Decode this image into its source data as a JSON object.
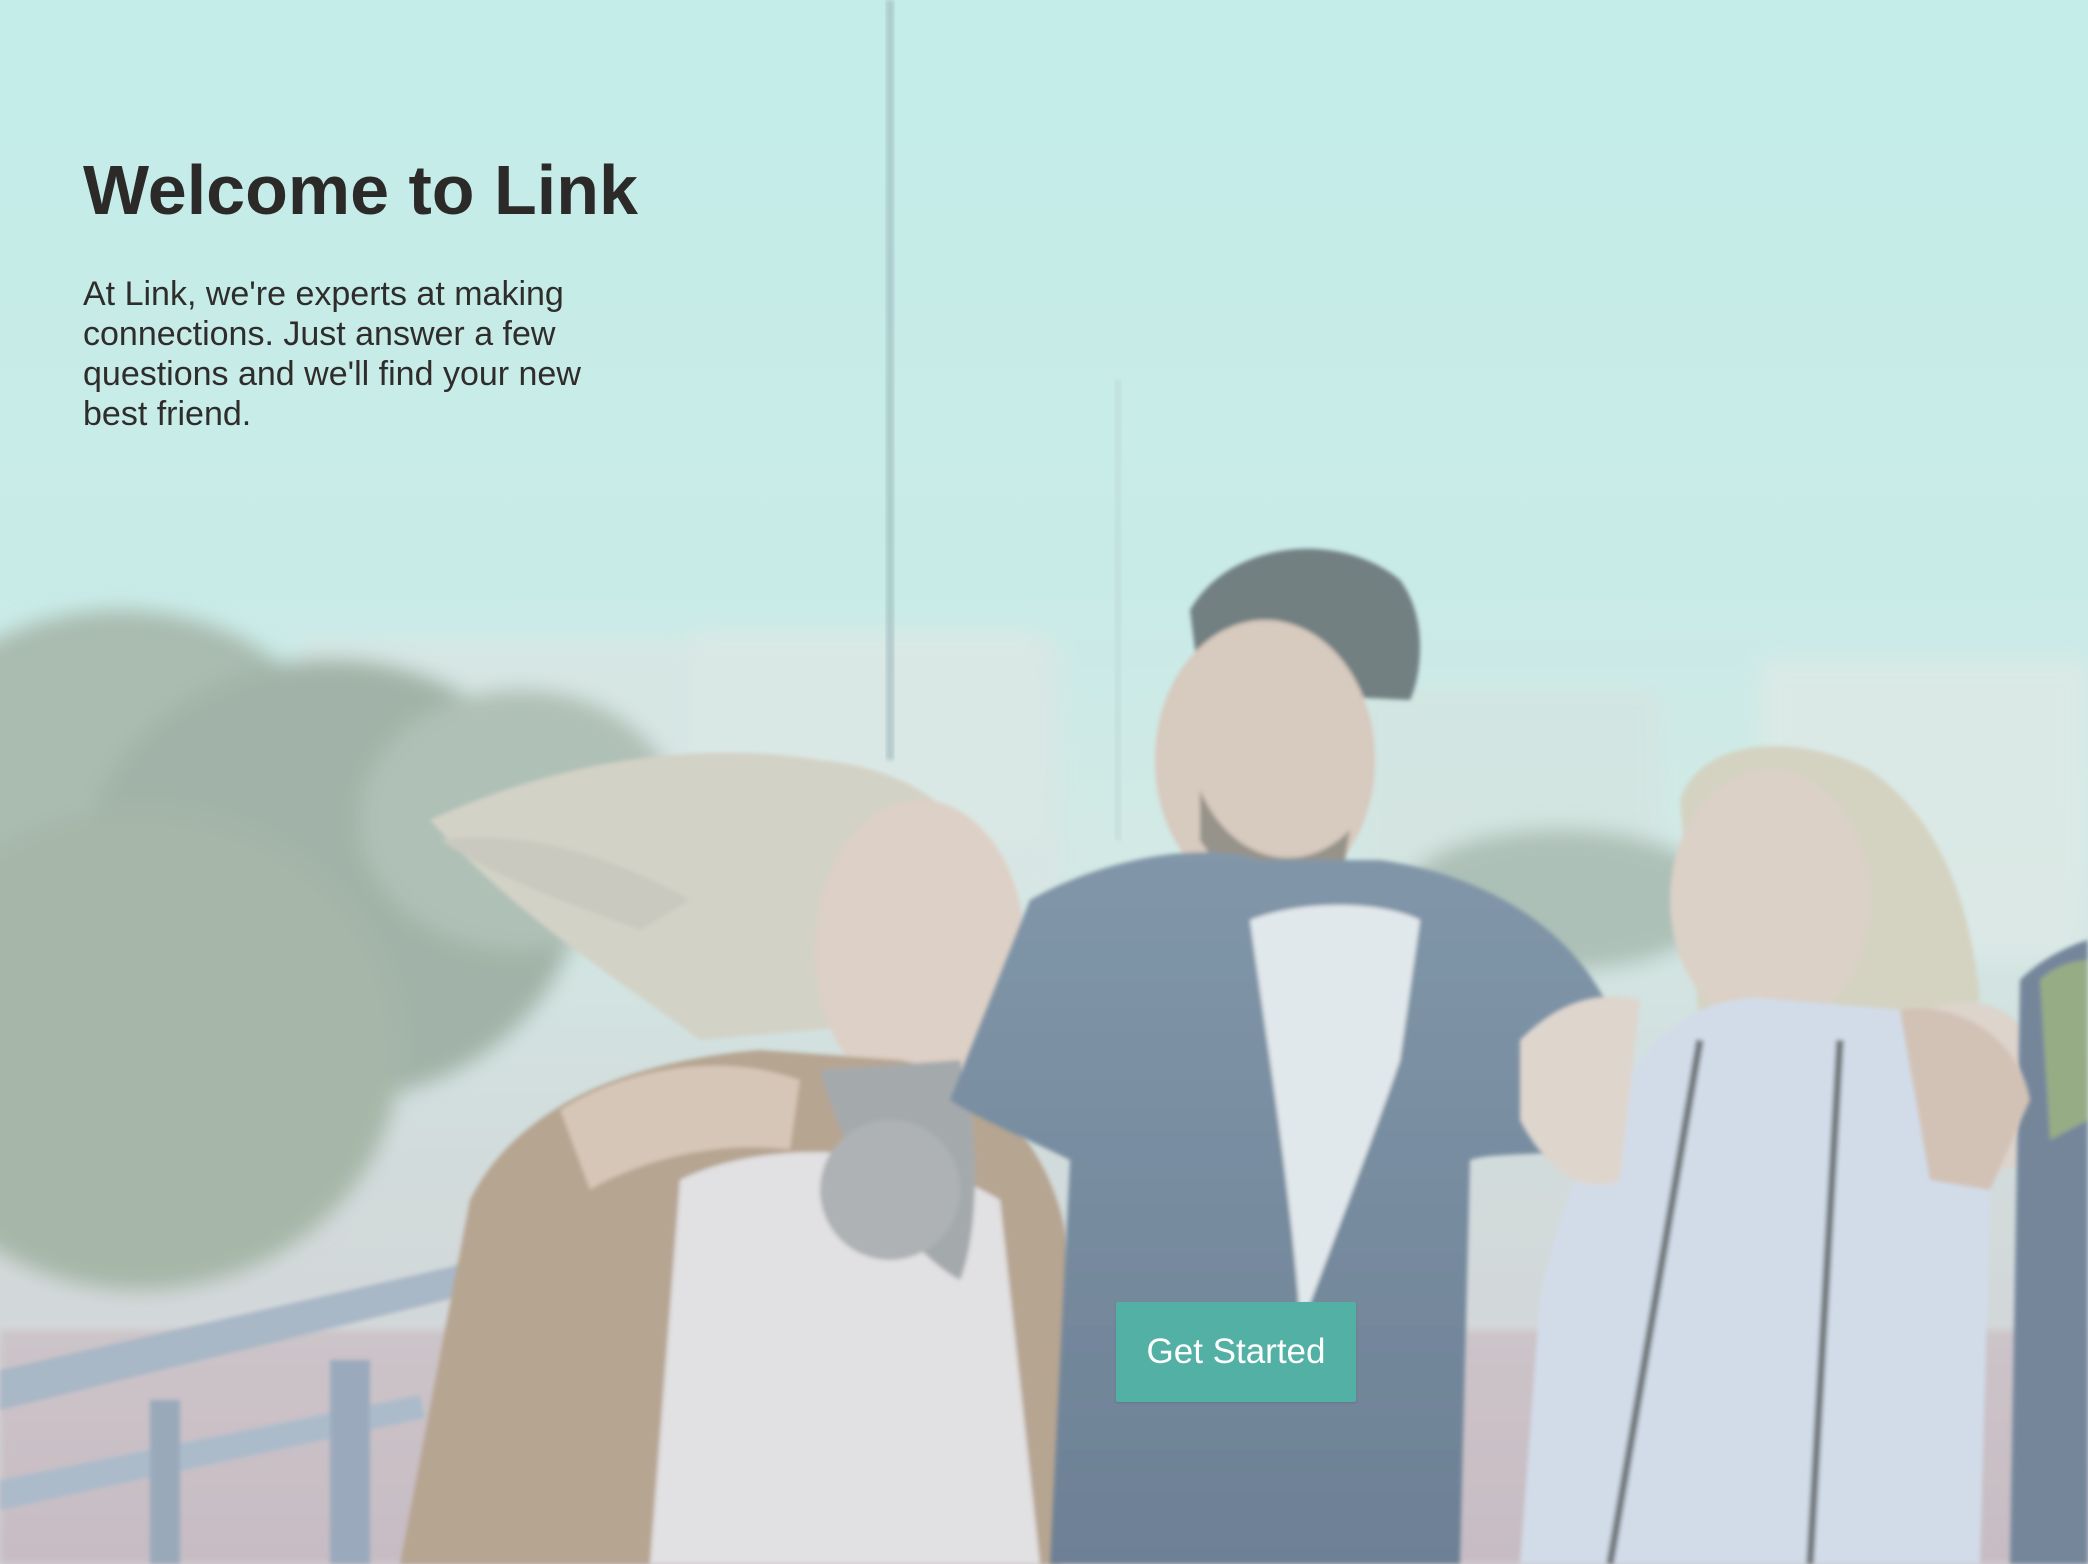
{
  "hero": {
    "title": "Welcome to Link",
    "body": "At Link, we're experts at making connections. Just answer a few questions and we'll find your new best friend."
  },
  "cta": {
    "label": "Get Started"
  },
  "colors": {
    "sky": "#c4ede9",
    "text": "#2c2a29",
    "button": "#52b0a4",
    "button_text": "#ffffff"
  }
}
